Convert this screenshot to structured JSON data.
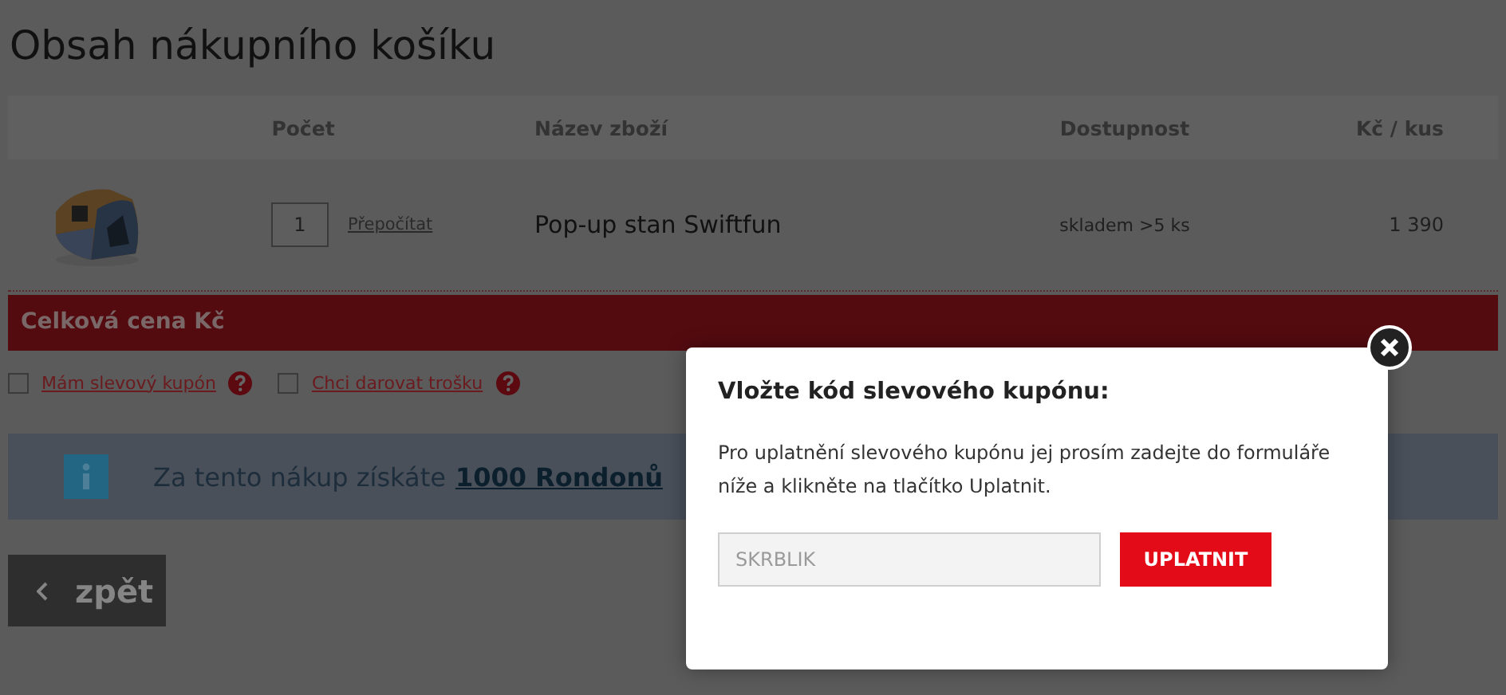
{
  "title": "Obsah nákupního košíku",
  "table": {
    "columns": [
      "Počet",
      "Název zboží",
      "Dostupnost",
      "Kč / kus"
    ],
    "rows": [
      {
        "kind": "picture",
        "quantity": "1",
        "recalc": "Přepočítat",
        "name": "Pop-up stan Swiftfun",
        "availability": "skladem >5 ks",
        "price": "1 390"
      }
    ]
  },
  "total_label": "Celková cena Kč",
  "options": [
    {
      "label": "Mám slevový kupón",
      "checked": false
    },
    {
      "label": "Chci darovat trošku",
      "checked": false
    }
  ],
  "info": {
    "text": "Za tento nákup získáte",
    "link": "1000 Rondonů"
  },
  "back_button": "zpět",
  "modal": {
    "title": "Vložte kód slevového kupónu:",
    "text": "Pro uplatnění slevového kupónu jej prosím zadejte do formuláře níže a klikněte na tlačítko Uplatnit.",
    "code_placeholder": "SKRBLIK",
    "button": "UPLATNIT"
  }
}
